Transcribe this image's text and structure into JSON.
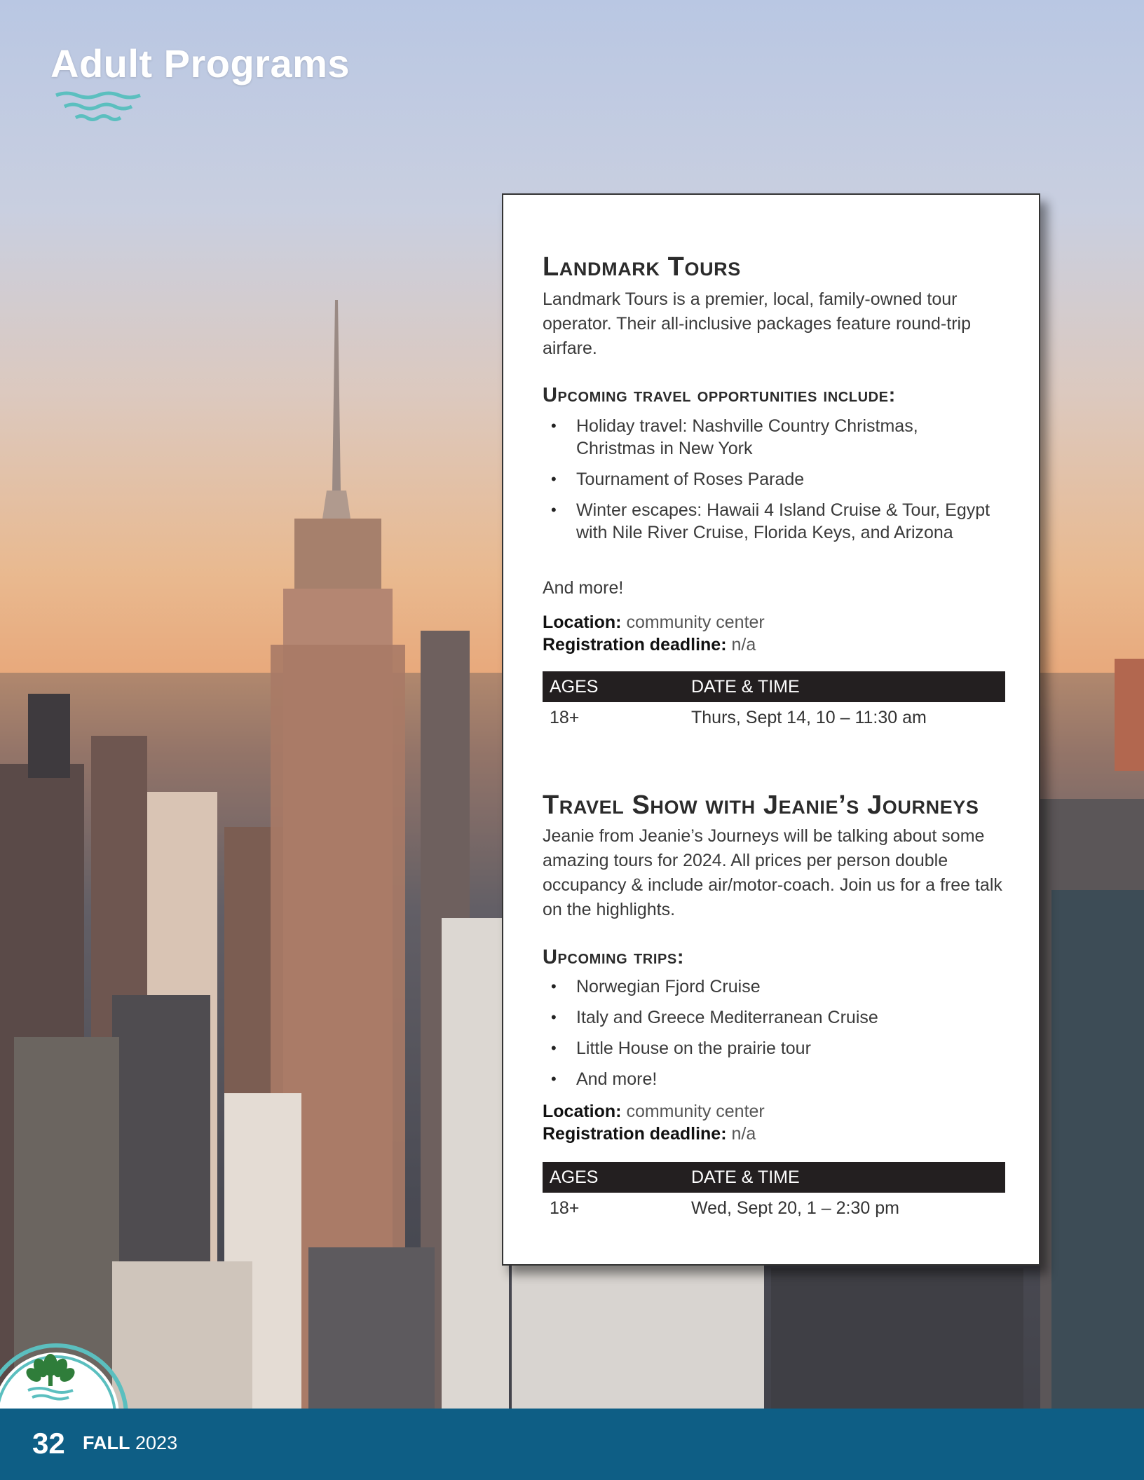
{
  "header": {
    "title": "Adult Programs",
    "waves_icon": "wave-lines-icon"
  },
  "colors": {
    "footer": "#0e5e85",
    "accent_teal": "#5bbfbf",
    "table_header": "#231f20"
  },
  "sections": [
    {
      "title": "Landmark Tours",
      "description": "Landmark Tours is a premier, local, family-owned tour operator. Their all-inclusive packages feature round-trip airfare.",
      "list_heading": "Upcoming travel opportunities include:",
      "items": [
        "Holiday travel: Nashville Country Christmas, Christmas in New York",
        "Tournament of Roses Parade",
        "Winter escapes: Hawaii 4 Island Cruise & Tour, Egypt with Nile River Cruise, Florida Keys, and Arizona"
      ],
      "after_list": "And more!",
      "location_label": "Location:",
      "location": "community center",
      "deadline_label": "Registration deadline:",
      "deadline": "n/a",
      "table": {
        "col1": "AGES",
        "col2": "DATE & TIME",
        "ages": "18+",
        "datetime": "Thurs, Sept 14, 10 – 11:30 am"
      }
    },
    {
      "title": "Travel Show with Jeanie’s Journeys",
      "description": "Jeanie from Jeanie’s Journeys will be talking about some amazing tours for 2024. All prices per person double occupancy & include air/motor-coach. Join us for a free talk on the highlights.",
      "list_heading": "Upcoming trips:",
      "items": [
        "Norwegian Fjord Cruise",
        "Italy and Greece Mediterranean Cruise",
        "Little House on the prairie tour",
        "And more!"
      ],
      "location_label": "Location:",
      "location": "community center",
      "deadline_label": "Registration deadline:",
      "deadline": "n/a",
      "table": {
        "col1": "AGES",
        "col2": "DATE & TIME",
        "ages": "18+",
        "datetime": "Wed, Sept 20, 1 – 2:30 pm"
      }
    }
  ],
  "footer": {
    "page_number": "32",
    "season": "FALL",
    "year": "2023",
    "logo_icon": "tree-logo-icon"
  }
}
